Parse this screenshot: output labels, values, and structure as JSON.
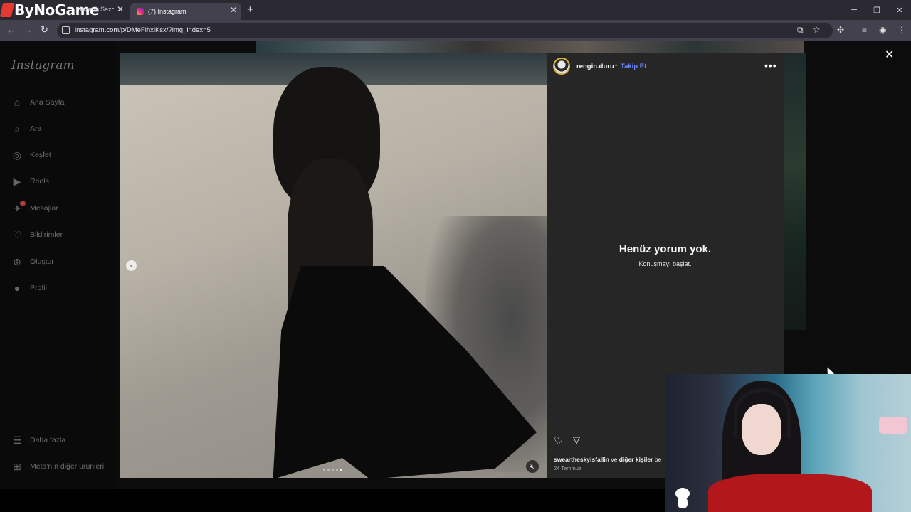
{
  "browser": {
    "inactive_tab": {
      "brand": "ByNoGame",
      "title": "Hazırlık Sezon"
    },
    "active_tab": {
      "title": "(7) Instagram"
    },
    "url": "instagram.com/p/DMeFihxlKsx/?img_index=5"
  },
  "sidebar": {
    "logo": "Instagram",
    "items": [
      {
        "label": "Ana Sayfa",
        "icon": "home-icon"
      },
      {
        "label": "Ara",
        "icon": "search-icon"
      },
      {
        "label": "Keşfet",
        "icon": "compass-icon"
      },
      {
        "label": "Reels",
        "icon": "reels-icon"
      },
      {
        "label": "Mesajlar",
        "icon": "messenger-icon",
        "badge": "7"
      },
      {
        "label": "Bildirimler",
        "icon": "heart-icon"
      },
      {
        "label": "Oluştur",
        "icon": "create-icon"
      },
      {
        "label": "Profil",
        "icon": "avatar-icon"
      },
      {
        "label": "Daha fazla",
        "icon": "menu-icon"
      },
      {
        "label": "Meta'nın diğer ürünleri",
        "icon": "meta-products-icon"
      }
    ]
  },
  "post": {
    "username": "rengin.duru",
    "separator": "•",
    "follow_label": "Takip Et",
    "empty_title": "Henüz yorum yok.",
    "empty_subtitle": "Konuşmayı başlat.",
    "likes_user": "sweartheskyisfallin",
    "likes_mid": "ve",
    "likes_others": "diğer kişiler",
    "likes_tail": "be",
    "date": "24 Temmuz",
    "carousel": {
      "count": 5,
      "active_index": 5
    }
  },
  "colors": {
    "follow_link": "#6d86ff",
    "panel_bg": "#262626",
    "tab_bar": "#2b2a33"
  }
}
